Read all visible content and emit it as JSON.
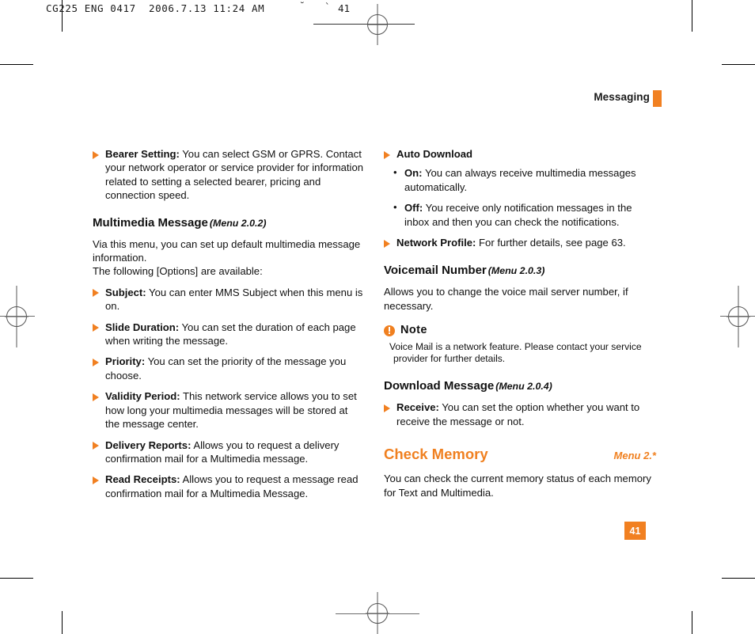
{
  "print_slug": {
    "text": "CG225 ENG 0417  2006.7.13 11:24 AM",
    "mark1": "˘",
    "mark2": "`",
    "page": "41"
  },
  "running_head": {
    "title": "Messaging",
    "accent_color": "#f18021"
  },
  "page_number": "41",
  "left_column": {
    "bullets_top": [
      {
        "term": "Bearer Setting:",
        "text": " You can select GSM or GPRS. Contact your network operator or service provider for information related to setting a selected bearer, pricing and connection speed."
      }
    ],
    "section": {
      "title": "Multimedia Message",
      "menu_ref": "(Menu 2.0.2)",
      "intro_line1": "Via this menu, you can set up default multimedia message information.",
      "intro_line2": "The following [Options] are available:"
    },
    "bullets": [
      {
        "term": "Subject:",
        "text": " You can enter MMS Subject when this menu is on."
      },
      {
        "term": "Slide Duration:",
        "text": " You can set the duration of each page when writing the message."
      },
      {
        "term": "Priority:",
        "text": " You can set the priority of the message you choose."
      },
      {
        "term": "Validity Period:",
        "text": " This network service allows you to set how long your multimedia messages will be stored at the message center."
      },
      {
        "term": "Delivery Reports:",
        "text": " Allows you to request a delivery confirmation mail for a Multimedia message."
      },
      {
        "term": "Read Receipts:",
        "text": " Allows you to request a message read confirmation mail for a Multimedia Message."
      }
    ]
  },
  "right_column": {
    "auto_download": {
      "term": "Auto Download",
      "sub_bullets": [
        {
          "term": "On:",
          "text": " You can always receive multimedia messages automatically."
        },
        {
          "term": "Off:",
          "text": " You receive only notification messages in the inbox and then you can check the notifications."
        }
      ]
    },
    "network_profile": {
      "term": "Network Profile:",
      "text": " For further details, see page 63."
    },
    "voicemail": {
      "title": "Voicemail Number",
      "menu_ref": "(Menu 2.0.3)",
      "body": "Allows you to change the voice mail server number, if necessary."
    },
    "note": {
      "icon": "info-exclamation-icon",
      "title": "Note",
      "line1": "Voice Mail is a network feature. Please contact your service",
      "line2": "provider for further details."
    },
    "download_message": {
      "title": "Download Message",
      "menu_ref": "(Menu 2.0.4)",
      "bullet": {
        "term": "Receive:",
        "text": " You can set the option whether you want to receive the message or not."
      }
    },
    "check_memory": {
      "title": "Check Memory",
      "menu_ref": "Menu 2.*",
      "body": "You can check the current memory status of each memory for Text and Multimedia."
    }
  }
}
